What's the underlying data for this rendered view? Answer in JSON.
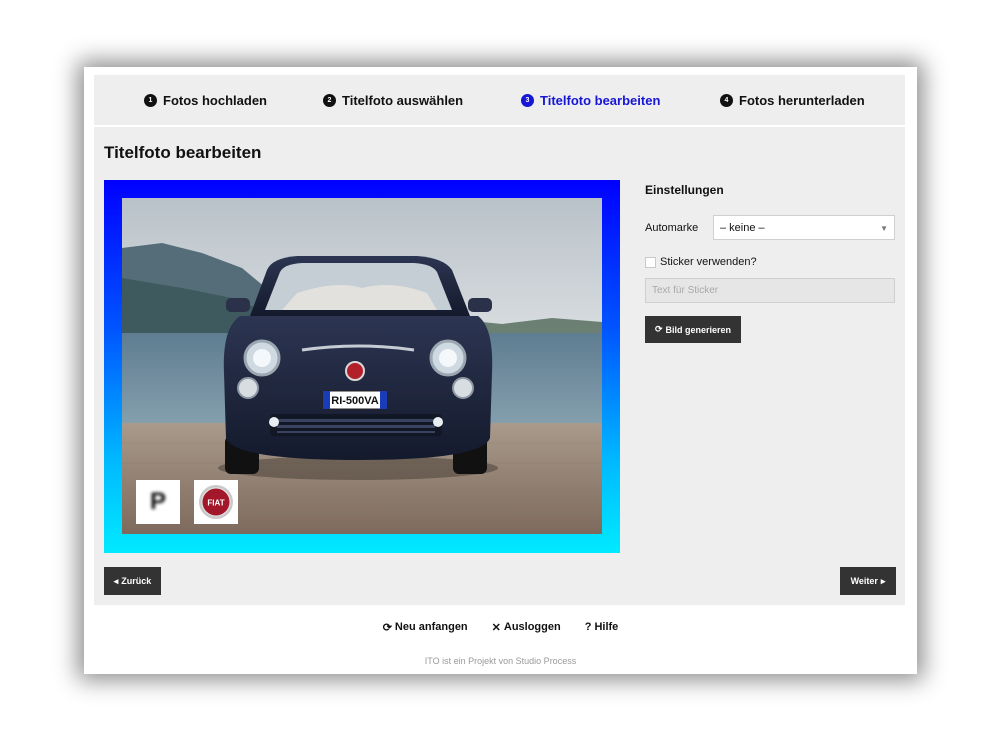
{
  "steps": [
    {
      "num": "1",
      "label": "Fotos hochladen"
    },
    {
      "num": "2",
      "label": "Titelfoto auswählen"
    },
    {
      "num": "3",
      "label": "Titelfoto bearbeiten"
    },
    {
      "num": "4",
      "label": "Fotos herunterladen"
    }
  ],
  "active_step": "3",
  "accent_color": "#1616d4",
  "page": {
    "title": "Titelfoto bearbeiten"
  },
  "photo": {
    "plate": "RI-500VA",
    "stickers": [
      "P",
      "FIAT"
    ]
  },
  "settings": {
    "title": "Einstellungen",
    "brand_label": "Automarke",
    "brand_value": "– keine –",
    "sticker_label": "Sticker verwenden?",
    "sticker_checked": false,
    "sticker_placeholder": "Text für Sticker",
    "generate_label": "Bild generieren"
  },
  "nav": {
    "back_label": "Zurück",
    "next_label": "Weiter"
  },
  "footer": {
    "restart_label": "Neu anfangen",
    "logout_label": "Ausloggen",
    "help_label": "Hilfe",
    "credit": "ITO ist ein Projekt von Studio Process"
  }
}
